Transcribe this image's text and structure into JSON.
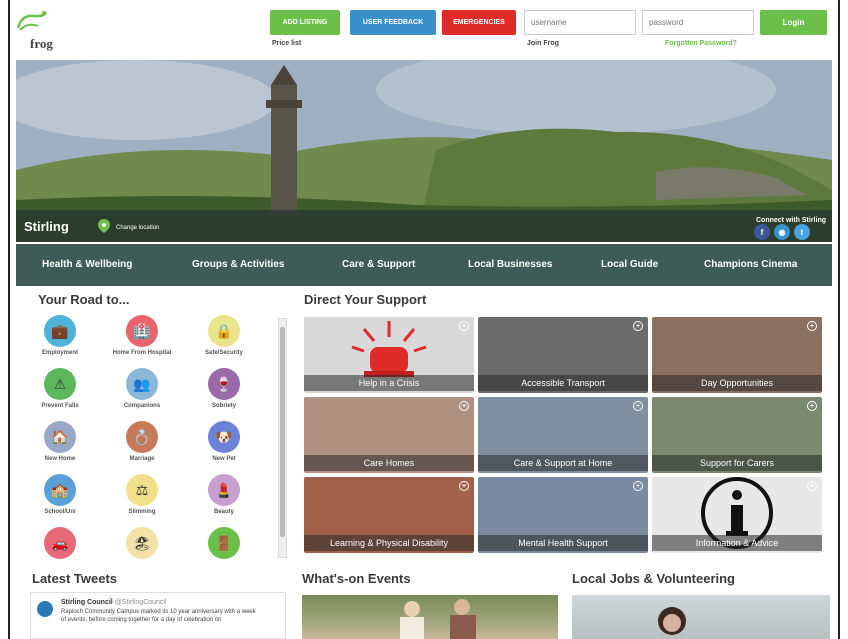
{
  "brand": {
    "logo_text": "frog"
  },
  "header": {
    "add_listing": "ADD LISTING",
    "user_feedback": "USER FEEDBACK",
    "emergencies": "EMERGENCIES",
    "username_placeholder": "username",
    "password_placeholder": "password",
    "login": "Login",
    "price_list": "Price list",
    "join": "Join Frog",
    "forgot": "Forgotten Password?"
  },
  "hero": {
    "location": "Stirling",
    "change_location": "Change location",
    "connect": "Connect with Stirling"
  },
  "nav": [
    "Health & Wellbeing",
    "Groups & Activities",
    "Care & Support",
    "Local Businesses",
    "Local Guide",
    "Champions Cinema"
  ],
  "road": {
    "title": "Your Road to...",
    "items": [
      {
        "label": "Employment",
        "icon": "briefcase-icon",
        "color": "#4fb3d9",
        "glyph": "💼"
      },
      {
        "label": "Home From Hospital",
        "icon": "hospital-icon",
        "color": "#e8656b",
        "glyph": "🏥"
      },
      {
        "label": "Safe/Security",
        "icon": "lock-icon",
        "color": "#e9e48a",
        "glyph": "🔒"
      },
      {
        "label": "Prevent Falls",
        "icon": "warning-icon",
        "color": "#5cb85c",
        "glyph": "⚠"
      },
      {
        "label": "Companions",
        "icon": "companions-icon",
        "color": "#8bb8d8",
        "glyph": "👥"
      },
      {
        "label": "Sobriety",
        "icon": "sobriety-icon",
        "color": "#9a6aa8",
        "glyph": "🍷"
      },
      {
        "label": "New Home",
        "icon": "house-icon",
        "color": "#9aa8c8",
        "glyph": "🏠"
      },
      {
        "label": "Marriage",
        "icon": "rings-icon",
        "color": "#c97a5a",
        "glyph": "💍"
      },
      {
        "label": "New Pet",
        "icon": "pet-icon",
        "color": "#6a82d8",
        "glyph": "🐶"
      },
      {
        "label": "School/Uni",
        "icon": "school-icon",
        "color": "#5aa0d8",
        "glyph": "🏫"
      },
      {
        "label": "Slimming",
        "icon": "scale-icon",
        "color": "#f0e08a",
        "glyph": "⚖"
      },
      {
        "label": "Beauty",
        "icon": "beauty-icon",
        "color": "#c8a0d0",
        "glyph": "💄"
      },
      {
        "label": "",
        "icon": "car-icon",
        "color": "#e86a7a",
        "glyph": "🚗"
      },
      {
        "label": "",
        "icon": "beach-icon",
        "color": "#f2e2a8",
        "glyph": "🏖"
      },
      {
        "label": "",
        "icon": "door-icon",
        "color": "#6cc04a",
        "glyph": "🚪"
      }
    ]
  },
  "support": {
    "title": "Direct Your Support",
    "tiles": [
      {
        "label": "Help in a Crisis",
        "bg": "#d9d9d9"
      },
      {
        "label": "Accessible Transport",
        "bg": "#6b6b6b"
      },
      {
        "label": "Day Opportunities",
        "bg": "#8a7060"
      },
      {
        "label": "Care Homes",
        "bg": "#b09080"
      },
      {
        "label": "Care & Support at Home",
        "bg": "#8090a0"
      },
      {
        "label": "Support for Carers",
        "bg": "#7a8a70"
      },
      {
        "label": "Learning & Physical Disability",
        "bg": "#a0604a"
      },
      {
        "label": "Mental Health Support",
        "bg": "#7a8aa0"
      },
      {
        "label": "Information & Advice",
        "bg": "#e8e8e8"
      }
    ]
  },
  "bottom": {
    "tweets_title": "Latest Tweets",
    "events_title": "What's-on Events",
    "jobs_title": "Local Jobs & Volunteering",
    "tweet": {
      "name": "Stirling Council",
      "handle": "@StirlingCouncil",
      "text": "Raploch Community Campus marked its 10 year anniversary with a week of events, before coming together for a day of celebration on"
    }
  }
}
